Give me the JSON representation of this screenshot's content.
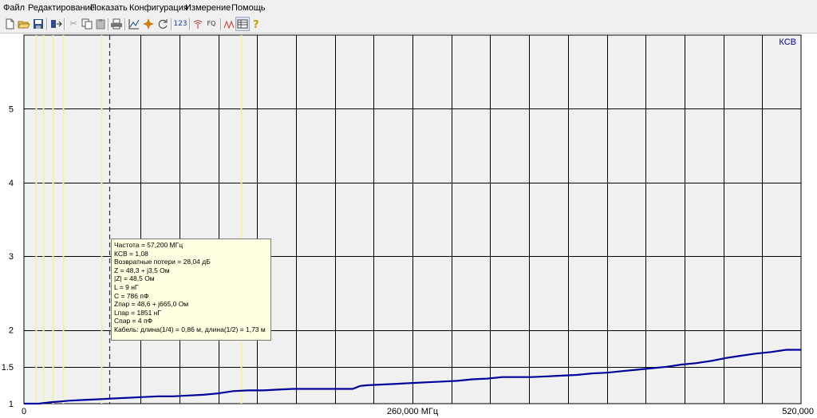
{
  "menu": {
    "file": "Файл",
    "edit": "Редактирование",
    "view": "Показать",
    "config": "Конфигурация",
    "measure": "Измерение",
    "help": "Помощь"
  },
  "toolbar": {
    "freq_label_button": "FQ",
    "count_button": "123"
  },
  "chart_data": {
    "type": "line",
    "series": [
      {
        "name": "КСВ",
        "color": "#00009c",
        "x": [
          0,
          10,
          18,
          25,
          30,
          40,
          50,
          60,
          70,
          80,
          90,
          100,
          110,
          120,
          130,
          140,
          150,
          160,
          170,
          180,
          190,
          200,
          210,
          220,
          225,
          230,
          240,
          250,
          260,
          270,
          280,
          290,
          300,
          310,
          320,
          330,
          340,
          350,
          360,
          370,
          380,
          390,
          400,
          410,
          420,
          430,
          440,
          450,
          460,
          470,
          480,
          490,
          500,
          510,
          520
        ],
        "y": [
          1.0,
          1.0,
          1.02,
          1.03,
          1.04,
          1.05,
          1.06,
          1.07,
          1.08,
          1.09,
          1.1,
          1.1,
          1.11,
          1.12,
          1.14,
          1.17,
          1.18,
          1.18,
          1.19,
          1.2,
          1.2,
          1.2,
          1.2,
          1.2,
          1.24,
          1.25,
          1.26,
          1.27,
          1.28,
          1.29,
          1.3,
          1.31,
          1.33,
          1.34,
          1.36,
          1.36,
          1.36,
          1.37,
          1.38,
          1.39,
          1.41,
          1.42,
          1.44,
          1.46,
          1.48,
          1.5,
          1.53,
          1.55,
          1.58,
          1.62,
          1.65,
          1.68,
          1.7,
          1.73,
          1.73
        ]
      }
    ],
    "xlim": [
      0,
      520
    ],
    "ylim": [
      1,
      6
    ],
    "x_ticks": [
      {
        "v": 0,
        "label": "0"
      },
      {
        "v": 260,
        "label": "260,000 МГц"
      },
      {
        "v": 520,
        "label": "520,000"
      }
    ],
    "y_ticks": [
      {
        "v": 1,
        "label": "1"
      },
      {
        "v": 1.5,
        "label": "1.5"
      },
      {
        "v": 2,
        "label": "2"
      },
      {
        "v": 3,
        "label": "3"
      },
      {
        "v": 4,
        "label": "4"
      },
      {
        "v": 5,
        "label": "5"
      }
    ],
    "grid": true,
    "legend": "КСВ",
    "legend_position": "top-right",
    "cursor_x": 57.2,
    "marker_x": [
      8,
      13,
      19,
      26,
      52,
      145
    ]
  },
  "tooltip": {
    "lines": [
      "Частота = 57,200 МГц",
      "КСВ = 1,08",
      "Возвратные потери = 28,04 дБ",
      "Z = 48,3 + j3,5 Ом",
      "|Z| = 48,5 Ом",
      "L = 9 нГ",
      "C = 786 пФ",
      "Zпар = 48,6 + j665,0 Ом",
      "Lпар = 1851 нГ",
      "Спар = 4 пФ",
      "Кабель: длина(1/4) = 0,86 м, длина(1/2) = 1,73 м"
    ]
  }
}
